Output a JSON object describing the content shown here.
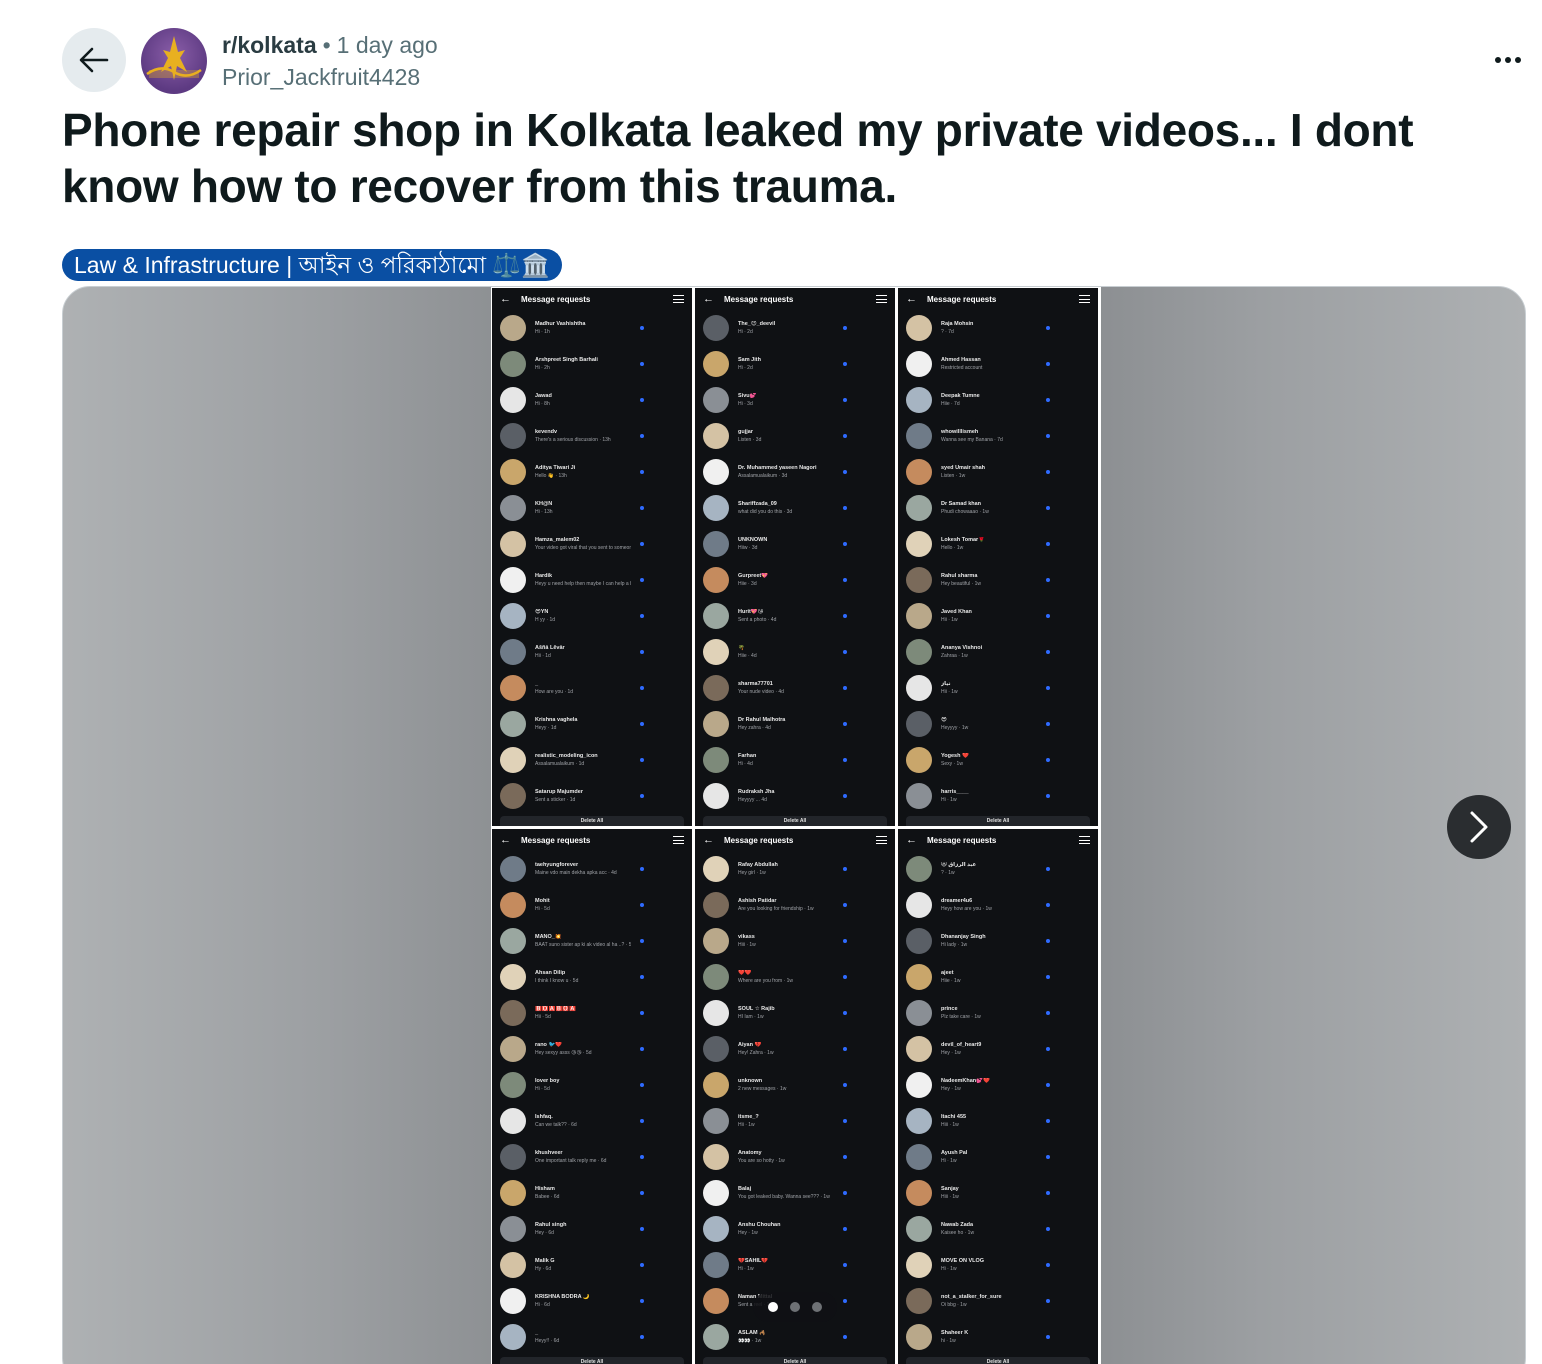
{
  "header": {
    "subreddit": "r/kolkata",
    "separator": "•",
    "time": "1 day ago",
    "author": "Prior_Jackfruit4428"
  },
  "post": {
    "title": "Phone repair shop in Kolkata leaked my private videos... I dont know how to recover from this trauma.",
    "flair": "Law & Infrastructure | আইন ও পরিকাঠামো ⚖️🏛️"
  },
  "gallery": {
    "pages": 3,
    "current_page": 1,
    "panels": [
      {
        "title": "Message requests",
        "delete_label": "Delete All",
        "rows": [
          {
            "name": "Madhur Vashishtha",
            "msg": "Hi · 1h"
          },
          {
            "name": "Arshpreet Singh Barhali",
            "msg": "Hi · 2h"
          },
          {
            "name": "Jawad",
            "msg": "Hi · 8h"
          },
          {
            "name": "kevendv",
            "msg": "There's a serious discussion · 13h"
          },
          {
            "name": "Aditya Tiwari Ji",
            "msg": "Hello 👋 · 13h"
          },
          {
            "name": "KH@N",
            "msg": "Hi · 13h"
          },
          {
            "name": "Hamza_malem02",
            "msg": "Your video got viral that you sent to someone ... 22h"
          },
          {
            "name": "Hardik",
            "msg": "Heyy u need help then maybe I can help a bit · 24h"
          },
          {
            "name": "😎YN",
            "msg": "H yy · 1d"
          },
          {
            "name": "Ãšñå Lêvår",
            "msg": "Hii · 1d"
          },
          {
            "name": "_",
            "msg": "How are you · 1d"
          },
          {
            "name": "Krishna vaghela",
            "msg": "Heyy · 1d"
          },
          {
            "name": "realistic_modeling_icon",
            "msg": "Assalamualaikum · 1d"
          },
          {
            "name": "Satarup Majumder",
            "msg": "Sent a sticker · 1d"
          }
        ]
      },
      {
        "title": "Message requests",
        "delete_label": "Delete All",
        "rows": [
          {
            "name": "The_😈_deevil",
            "msg": "Hi · 2d"
          },
          {
            "name": "Sam Jith",
            "msg": "Hi · 2d"
          },
          {
            "name": "Sivu💕",
            "msg": "Hi · 3d"
          },
          {
            "name": "gujjar",
            "msg": "Listen · 3d"
          },
          {
            "name": "Dr. Muhammed yaseen Nagori",
            "msg": "Assalamualaikum · 3d"
          },
          {
            "name": "Shariffzada_09",
            "msg": "what did you do this · 3d"
          },
          {
            "name": "UNKNOWN",
            "msg": "Hiiw · 3d"
          },
          {
            "name": "Gurpreet💖",
            "msg": "Hiie · 3d"
          },
          {
            "name": "Hurit💖😘",
            "msg": "Sent a photo · 4d"
          },
          {
            "name": "🌴",
            "msg": "Hiie · 4d"
          },
          {
            "name": "sharma77701",
            "msg": "Your nude video · 4d"
          },
          {
            "name": "Dr Rahul Malhotra",
            "msg": "Hey zahra · 4d"
          },
          {
            "name": "Farhan",
            "msg": "Hi · 4d"
          },
          {
            "name": "Rudraksh Jha",
            "msg": "Heyyyy ... 4d"
          }
        ]
      },
      {
        "title": "Message requests",
        "delete_label": "Delete All",
        "rows": [
          {
            "name": "Raja Mohsin",
            "msg": "? · 7d"
          },
          {
            "name": "Ahmed Hassan",
            "msg": "Restricted account"
          },
          {
            "name": "Deepak Tumne",
            "msg": "Hiie · 7d"
          },
          {
            "name": "whowilllismeh",
            "msg": "Wanna see my Banana · 7d"
          },
          {
            "name": "syed Umair shah",
            "msg": "Listen · 1w"
          },
          {
            "name": "Dr Samad khan",
            "msg": "Phudi chowaaao · 1w"
          },
          {
            "name": "Lokesh Tomar🌹",
            "msg": "Hello · 1w"
          },
          {
            "name": "Rahul sharma",
            "msg": "Hey beautiful · 1w"
          },
          {
            "name": "Javed Khan",
            "msg": "Hii · 1w"
          },
          {
            "name": "Ananya Vishnoi",
            "msg": "Zahraa · 1w"
          },
          {
            "name": "نیاز",
            "msg": "Hii · 1w"
          },
          {
            "name": "😎",
            "msg": "Heyyyy · 1w"
          },
          {
            "name": "Yogesh ❤️",
            "msg": "Sexy · 1w"
          },
          {
            "name": "harris____",
            "msg": "Hi · 1w"
          }
        ]
      },
      {
        "title": "Message requests",
        "delete_label": "Delete All",
        "rows": [
          {
            "name": "taehyungforever",
            "msg": "Maine vdo main dekha apka acc · 4d"
          },
          {
            "name": "Mohit",
            "msg": "Hi · 5d"
          },
          {
            "name": "MANO_💥",
            "msg": "BAAT suno sister ap ki ak video al ha ..? · 5d"
          },
          {
            "name": "Ahsan Dilip",
            "msg": "I think I know u · 5d"
          },
          {
            "name": "🅱️🅾️🅰️🅱️🅾️🅰️",
            "msg": "Hii · 5d"
          },
          {
            "name": "rano 🐦❤️",
            "msg": "Hey sexyy asss 😘😘 · 5d"
          },
          {
            "name": "lover boy",
            "msg": "Hi · 5d"
          },
          {
            "name": "Ishfaq.",
            "msg": "Can we talk?? · 6d"
          },
          {
            "name": "khushveer",
            "msg": "One important talk reply me · 6d"
          },
          {
            "name": "Hisham",
            "msg": "Babee · 6d"
          },
          {
            "name": "Rahul singh",
            "msg": "Hey · 6d"
          },
          {
            "name": "Malik G",
            "msg": "Hy · 6d"
          },
          {
            "name": "KRISHNA BODRA 🌙",
            "msg": "Hi · 6d"
          },
          {
            "name": "_",
            "msg": "Heyy!! · 6d"
          }
        ]
      },
      {
        "title": "Message requests",
        "delete_label": "Delete All",
        "rows": [
          {
            "name": "Rafay Abdullah",
            "msg": "Hey girl · 1w"
          },
          {
            "name": "Ashish Patidar",
            "msg": "Are you looking for friendship · 1w"
          },
          {
            "name": "vikass",
            "msg": "Hiii · 1w"
          },
          {
            "name": "❤️❤️",
            "msg": "Where are you from · 1w"
          },
          {
            "name": "SOUL ☆ Rajib",
            "msg": "HI Iam · 1w"
          },
          {
            "name": "Aiyan 💔",
            "msg": "Hey! Zahra · 1w"
          },
          {
            "name": "unknown",
            "msg": "2 new messages · 1w"
          },
          {
            "name": "itsme_?",
            "msg": "Hii · 1w"
          },
          {
            "name": "Anatomy",
            "msg": "You are so hotty · 1w"
          },
          {
            "name": "Balaj",
            "msg": "You got leaked baby. Wanna see??? · 1w"
          },
          {
            "name": "Anshu Chouhan",
            "msg": "Hey · 1w"
          },
          {
            "name": "💔SAHIL💔",
            "msg": "Hi · 1w"
          },
          {
            "name": "Naman Mittal",
            "msg": "Sent a reel · 1w"
          },
          {
            "name": "ASLAM 🦂",
            "msg": "👀👀 · 1w"
          }
        ]
      },
      {
        "title": "Message requests",
        "delete_label": "Delete All",
        "rows": [
          {
            "name": "😻 عبد الرزاق",
            "msg": "? · 1w"
          },
          {
            "name": "dreamer4u6",
            "msg": "Heyy how are you · 1w"
          },
          {
            "name": "Dhananjay Singh",
            "msg": "Hi lady · 1w"
          },
          {
            "name": "ajeet",
            "msg": "Hiie · 1w"
          },
          {
            "name": "prince",
            "msg": "Plz take care · 1w"
          },
          {
            "name": "devil_of_heart9",
            "msg": "Hey · 1w"
          },
          {
            "name": "NadeemKhan💕❤️",
            "msg": "Hey · 1w"
          },
          {
            "name": "Itachi 455",
            "msg": "Hiii · 1w"
          },
          {
            "name": "Ayush Pal",
            "msg": "Hi · 1w"
          },
          {
            "name": "Sanjay",
            "msg": "Hiii · 1w"
          },
          {
            "name": "Nawab Zada",
            "msg": "Kaisee ho · 1w"
          },
          {
            "name": "MOVE ON VLOG",
            "msg": "Hi · 1w"
          },
          {
            "name": "not_a_stalker_for_sure",
            "msg": "Oi bbg · 1w"
          },
          {
            "name": "Shaheer K",
            "msg": "hi · 1w"
          }
        ]
      }
    ]
  },
  "icons": {
    "back": "arrow-left-icon",
    "more": "ellipsis-icon",
    "next": "chevron-right-icon"
  },
  "colors": {
    "flair_bg": "#0a4fa3",
    "unread_dot": "#2f6bff",
    "panel_bg": "#0f1114"
  }
}
